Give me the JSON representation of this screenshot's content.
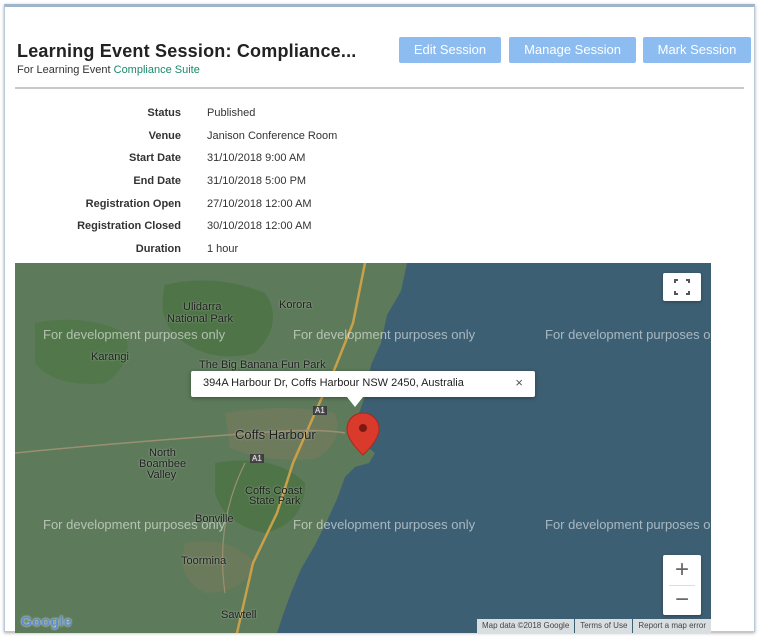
{
  "header": {
    "title": "Learning Event Session: Compliance...",
    "subtitle_prefix": "For Learning Event ",
    "subtitle_link": "Compliance Suite",
    "buttons": {
      "edit": "Edit Session",
      "manage": "Manage Session",
      "mark": "Mark Session"
    }
  },
  "details": [
    {
      "label": "Status",
      "value": "Published"
    },
    {
      "label": "Venue",
      "value": "Janison Conference Room"
    },
    {
      "label": "Start Date",
      "value": "31/10/2018 9:00 AM"
    },
    {
      "label": "End Date",
      "value": "31/10/2018 5:00 PM"
    },
    {
      "label": "Registration Open",
      "value": "27/10/2018 12:00 AM"
    },
    {
      "label": "Registration Closed",
      "value": "30/10/2018 12:00 AM"
    },
    {
      "label": "Duration",
      "value": "1 hour"
    }
  ],
  "map": {
    "watermark": "For development purposes only",
    "info_window": {
      "address": "394A Harbour Dr, Coffs Harbour NSW 2450, Australia",
      "close": "×"
    },
    "labels": {
      "ulidarra_1": "Ulidarra",
      "ulidarra_2": "National Park",
      "korora": "Korora",
      "karangi": "Karangi",
      "big_banana": "The Big Banana Fun Park",
      "coffs_harbour": "Coffs Harbour",
      "north_boambee_1": "North",
      "north_boambee_2": "Boambee",
      "north_boambee_3": "Valley",
      "coffs_coast_1": "Coffs Coast",
      "coffs_coast_2": "State Park",
      "bonville": "Bonville",
      "toormina": "Toormina",
      "sawtell": "Sawtell",
      "road_a1_1": "A1",
      "road_a1_2": "A1"
    },
    "zoom_in": "+",
    "zoom_out": "−",
    "logo": "Google",
    "footer": {
      "map_data": "Map data ©2018 Google",
      "terms": "Terms of Use",
      "report": "Report a map error"
    },
    "colors": {
      "ocean": "#3d5f73",
      "land": "#5d7a5a",
      "park": "#4f7448",
      "marker": "#d93a2b"
    }
  }
}
